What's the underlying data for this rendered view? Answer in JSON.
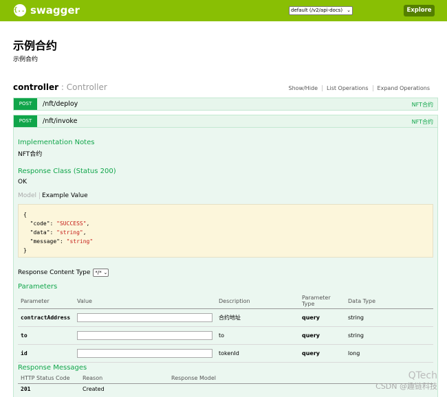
{
  "topbar": {
    "brand": "swagger",
    "logo_glyph": "{...}",
    "spec_selected": "default (/v2/api-docs)",
    "explore_label": "Explore",
    "bg_color": "#89bf04"
  },
  "info": {
    "title": "示例合约",
    "description": "示例合约"
  },
  "controller": {
    "name": "controller",
    "separator": " : ",
    "description": "Controller",
    "actions": [
      "Show/Hide",
      "List Operations",
      "Expand Operations"
    ]
  },
  "operations": [
    {
      "method": "POST",
      "path": "/nft/deploy",
      "summary": "NFT合约"
    },
    {
      "method": "POST",
      "path": "/nft/invoke",
      "summary": "NFT合约"
    }
  ],
  "invoke_detail": {
    "impl_notes_title": "Implementation Notes",
    "impl_notes": "NFT合约",
    "response_class_title": "Response Class (Status 200)",
    "response_class": "OK",
    "tab_model": "Model",
    "tab_example": "Example Value",
    "sample_lines": [
      {
        "prefix": "{",
        "value": "",
        "suffix": ""
      },
      {
        "prefix": "  \"code\": ",
        "value": "\"SUCCESS\"",
        "suffix": ","
      },
      {
        "prefix": "  \"data\": ",
        "value": "\"string\"",
        "suffix": ","
      },
      {
        "prefix": "  \"message\": ",
        "value": "\"string\"",
        "suffix": ""
      },
      {
        "prefix": "}",
        "value": "",
        "suffix": ""
      }
    ],
    "response_content_type_label": "Response Content Type",
    "response_content_type_value": "*/*",
    "parameters_title": "Parameters",
    "param_headers": [
      "Parameter",
      "Value",
      "Description",
      "Parameter Type",
      "Data Type"
    ],
    "params": [
      {
        "name": "contractAddress",
        "description": "合约地址",
        "param_type": "query",
        "data_type": "string"
      },
      {
        "name": "to",
        "description": "to",
        "param_type": "query",
        "data_type": "string"
      },
      {
        "name": "id",
        "description": "tokenId",
        "param_type": "query",
        "data_type": "long"
      }
    ],
    "response_messages_title": "Response Messages",
    "resp_headers": [
      "HTTP Status Code",
      "Reason",
      "Response Model"
    ],
    "responses": [
      {
        "code": "201",
        "reason": "Created",
        "model": ""
      }
    ]
  },
  "watermark": {
    "brand": "QTech",
    "credit": "CSDN @趣链科技"
  }
}
